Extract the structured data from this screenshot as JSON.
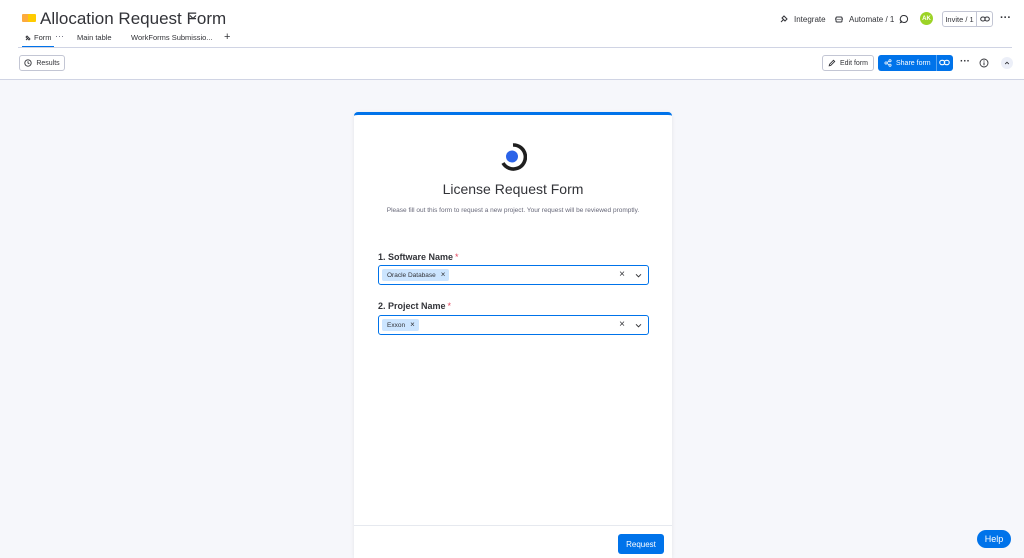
{
  "header": {
    "board_title": "Allocation Request Form",
    "integrate_label": "Integrate",
    "automate_label": "Automate / 1",
    "avatar_initials": "AK",
    "invite_label": "Invite / 1"
  },
  "tabs": [
    {
      "label": "Form",
      "active": true
    },
    {
      "label": "Main table",
      "active": false
    },
    {
      "label": "WorkForms Submissio...",
      "active": false
    }
  ],
  "toolbar": {
    "results_label": "Results",
    "edit_form_label": "Edit form",
    "share_form_label": "Share form"
  },
  "form": {
    "title": "License Request Form",
    "description": "Please fill out this form to request a new project. Your request will be reviewed promptly.",
    "questions": [
      {
        "label": "1. Software Name",
        "required_mark": "*",
        "selected_value": "Oracle Database"
      },
      {
        "label": "2. Project Name",
        "required_mark": "*",
        "selected_value": "Exxon"
      }
    ],
    "submit_label": "Request"
  },
  "help_label": "Help",
  "colors": {
    "accent": "#0073ea",
    "chip_bg": "#cce5ff",
    "required": "#e2445c",
    "avatar": "#9cd326"
  }
}
